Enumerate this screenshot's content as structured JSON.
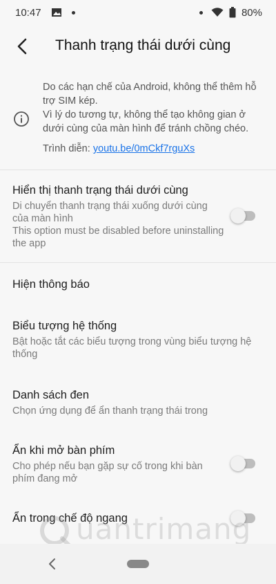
{
  "statusbar": {
    "time": "10:47",
    "battery_percent": "80%",
    "icons": [
      "image-icon",
      "notification-dot-icon",
      "dot-icon",
      "wifi-icon",
      "battery-icon"
    ]
  },
  "appbar": {
    "title": "Thanh trạng thái dưới cùng"
  },
  "notice": {
    "text_1": "Do các hạn chế của Android, không thể thêm hỗ trợ SIM kép.",
    "text_2": "Vì lý do tương tự, không thể tạo không gian ở dưới cùng của màn hình để tránh chồng chéo.",
    "link_label": "Trình diễn: ",
    "link_text": "youtu.be/0mCkf7rguXs"
  },
  "preferences": [
    {
      "title": "Hiển thị thanh trạng thái dưới cùng",
      "summary_1": "Di chuyển thanh trạng thái xuống dưới cùng của màn hình",
      "summary_2": "This option must be disabled before uninstalling the app",
      "switch_on": false
    },
    {
      "title": "Hiện thông báo"
    },
    {
      "title": "Biểu tượng hệ thống",
      "summary_1": "Bật hoặc tắt các biểu tượng trong vùng biểu tượng hệ thống"
    },
    {
      "title": "Danh sách đen",
      "summary_1": "Chọn ứng dụng để ẩn thanh trạng thái trong"
    },
    {
      "title": "Ẩn khi mở bàn phím",
      "summary_1": "Cho phép nếu bạn gặp sự cố trong khi bàn phím đang mở",
      "switch_on": false
    },
    {
      "title": "Ẩn trong chế độ ngang",
      "switch_on": false
    }
  ],
  "watermark": {
    "text": "uantrimang"
  },
  "colors": {
    "link": "#1a73e8",
    "switch_track_off": "#bdbdbd",
    "background": "#f7f7f7"
  }
}
